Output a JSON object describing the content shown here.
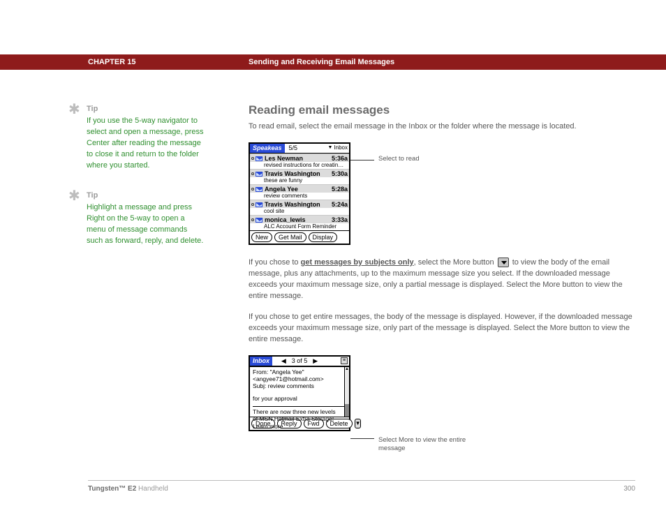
{
  "header": {
    "chapter": "CHAPTER 15",
    "title": "Sending and Receiving Email Messages"
  },
  "sidebar": {
    "tips": [
      {
        "label": "Tip",
        "body": "If you use the 5-way navigator to select and open a message, press Center after reading the message to close it and return to the folder where you started."
      },
      {
        "label": "Tip",
        "body": "Highlight a message and press Right on the 5-way to open a menu of message commands such as forward, reply, and delete."
      }
    ]
  },
  "main": {
    "heading": "Reading email messages",
    "intro": "To read email, select the email message in the Inbox or the folder where the message is located.",
    "para2_prefix": "If you chose to ",
    "para2_link": "get messages by subjects only",
    "para2_mid": ", select the More button ",
    "para2_suffix": " to view the body of the email message, plus any attachments, up to the maximum message size you select. If the downloaded message exceeds your maximum message size, only a partial message is displayed. Select the More button to view the entire message.",
    "para3": "If you chose to get entire messages, the body of the message is displayed. However, if the downloaded message exceeds your maximum message size, only part of the message is displayed. Select the More button to view the entire message.",
    "callout1": "Select to read",
    "callout2": "Select More to view the entire message"
  },
  "shot1": {
    "tab": "Speakeas",
    "count": "5/5",
    "folder": "Inbox",
    "rows": [
      {
        "sender": "Les Newman",
        "time": "5:36a",
        "subject": "revised instructions for creatin…"
      },
      {
        "sender": "Travis Washington",
        "time": "5:30a",
        "subject": "these are funny"
      },
      {
        "sender": "Angela Yee",
        "time": "5:28a",
        "subject": "review comments"
      },
      {
        "sender": "Travis Washington",
        "time": "5:24a",
        "subject": "cool site"
      },
      {
        "sender": "monica_lewis",
        "time": "3:33a",
        "subject": "ALC Account Form Reminder"
      }
    ],
    "buttons": {
      "new": "New",
      "get": "Get Mail",
      "display": "Display"
    }
  },
  "shot2": {
    "tab": "Inbox",
    "pager": "3 of 5",
    "from_label": "From:",
    "from_value": "\"Angela Yee\"",
    "from_addr": "<angyee71@hotmail.com>",
    "subj_label": "Subj:",
    "subj_value": "review comments",
    "body_line": "for your approval",
    "footer_text": "There are now three new levels of MSN Hotmail Extra Storage! Learn more.",
    "buttons": {
      "done": "Done",
      "reply": "Reply",
      "fwd": "Fwd",
      "delete": "Delete"
    }
  },
  "footer": {
    "product_bold": "Tungsten™ E2",
    "product_light": " Handheld",
    "page": "300"
  }
}
